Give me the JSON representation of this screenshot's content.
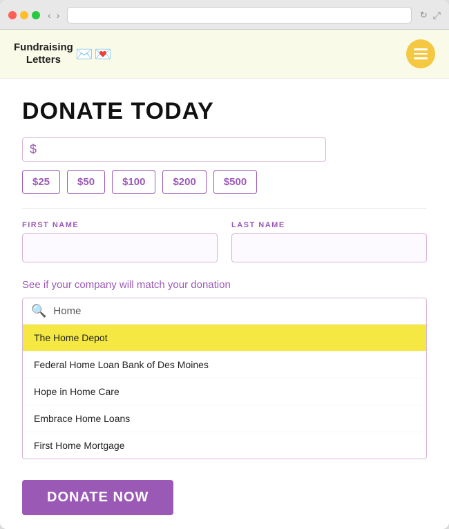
{
  "browser": {
    "traffic_lights": [
      "red",
      "yellow",
      "green"
    ],
    "nav_back": "‹",
    "nav_forward": "›",
    "address": "",
    "reload": "↻",
    "expand": "⤢"
  },
  "header": {
    "logo_text_line1": "Fundraising",
    "logo_text_line2": "Letters",
    "hamburger_aria": "Menu"
  },
  "main": {
    "title": "DONATE TODAY",
    "dollar_sign": "$",
    "amount_placeholder": "",
    "preset_amounts": [
      "$25",
      "$50",
      "$100",
      "$200",
      "$500"
    ],
    "first_name_label": "FIRST NAME",
    "last_name_label": "LAST NAME",
    "match_label": "See if your company will match your donation",
    "search_placeholder": "Home",
    "company_list": [
      {
        "name": "The Home Depot",
        "highlighted": true
      },
      {
        "name": "Federal Home Loan Bank of Des Moines",
        "highlighted": false
      },
      {
        "name": "Hope in Home Care",
        "highlighted": false
      },
      {
        "name": "Embrace Home Loans",
        "highlighted": false
      },
      {
        "name": "First Home Mortgage",
        "highlighted": false
      }
    ],
    "donate_button": "DONATE NOW"
  }
}
